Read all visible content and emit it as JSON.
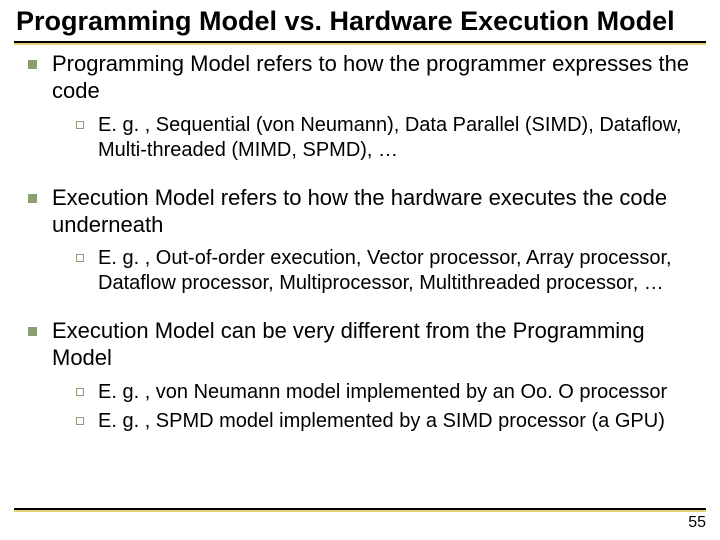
{
  "title": "Programming Model vs. Hardware Execution Model",
  "bullets": [
    {
      "text": "Programming Model refers to how the programmer expresses the code",
      "sub": [
        "E. g. , Sequential (von Neumann), Data Parallel (SIMD), Dataflow, Multi-threaded (MIMD, SPMD), …"
      ]
    },
    {
      "text": "Execution Model refers to how the hardware executes the code underneath",
      "sub": [
        "E. g. , Out-of-order execution, Vector processor, Array processor, Dataflow processor, Multiprocessor, Multithreaded processor, …"
      ]
    },
    {
      "text": "Execution Model can be very different from the Programming Model",
      "sub": [
        "E. g. , von Neumann model implemented by an Oo. O processor",
        "E. g. , SPMD model implemented by a SIMD processor (a GPU)"
      ]
    }
  ],
  "page_number": "55"
}
